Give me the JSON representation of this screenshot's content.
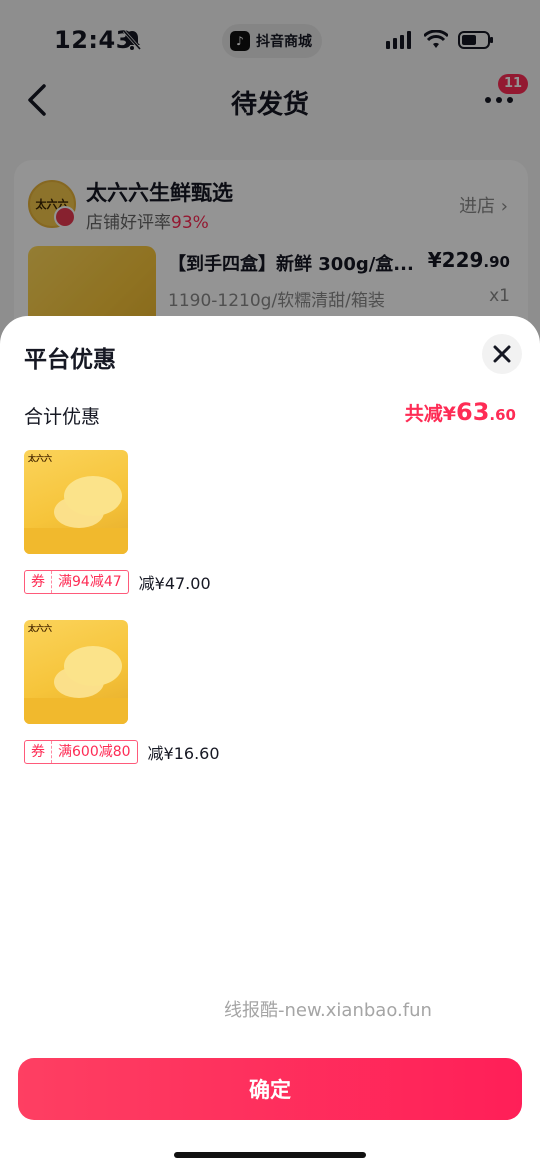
{
  "status_bar": {
    "time": "12:43",
    "app_name": "抖音商城"
  },
  "nav": {
    "title": "待发货",
    "badge_count": "11"
  },
  "shop": {
    "name": "太六六生鲜甄选",
    "rating_label": "店铺好评率",
    "rating_value": "93%",
    "enter_label": "进店",
    "avatar_text": "太六六",
    "product": {
      "title": "【到手四盒】新鲜 300g/盒...",
      "price_symbol": "¥",
      "price_int": "229",
      "price_dec": ".90",
      "spec": "1190-1210g/软糯清甜/箱装",
      "qty": "x1"
    }
  },
  "sheet": {
    "title": "平台优惠",
    "summary_label": "合计优惠",
    "summary_prefix": "共减",
    "summary_symbol": "¥",
    "summary_int": "63",
    "summary_dec": ".60",
    "coupons": [
      {
        "kind": "券",
        "condition": "满94减47",
        "amount": "减¥47.00"
      },
      {
        "kind": "券",
        "condition": "满600减80",
        "amount": "减¥16.60"
      }
    ],
    "watermark": "线报酷-new.xianbao.fun",
    "confirm_label": "确定"
  },
  "colors": {
    "accent": "#fe2c55",
    "product_yellow": "#f7c53a"
  }
}
